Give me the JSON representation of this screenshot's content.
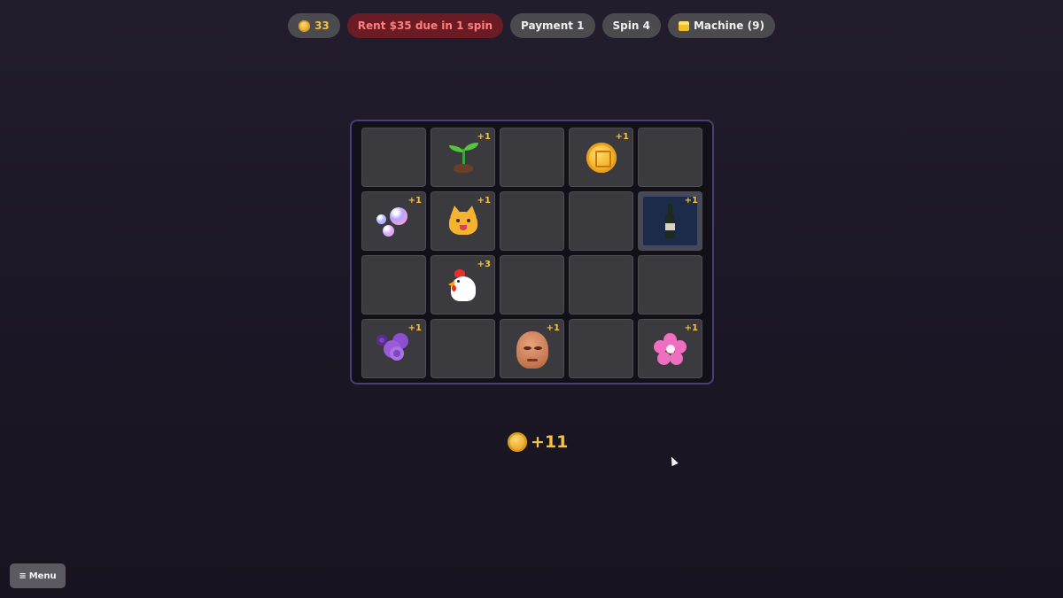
{
  "topbar": {
    "coins": "33",
    "rent": "Rent $35 due in 1 spin",
    "payment": "Payment 1",
    "spin": "Spin 4",
    "machine": "Machine (9)"
  },
  "board": {
    "cells": [
      {
        "symbol": "",
        "bonus": ""
      },
      {
        "symbol": "seedling-icon",
        "bonus": "+1"
      },
      {
        "symbol": "",
        "bonus": ""
      },
      {
        "symbol": "coin-icon",
        "bonus": "+1"
      },
      {
        "symbol": "",
        "bonus": ""
      },
      {
        "symbol": "bubbles-icon",
        "bonus": "+1"
      },
      {
        "symbol": "cat-icon",
        "bonus": "+1"
      },
      {
        "symbol": "",
        "bonus": ""
      },
      {
        "symbol": "",
        "bonus": ""
      },
      {
        "symbol": "wine-bottle-icon",
        "bonus": "+1"
      },
      {
        "symbol": "",
        "bonus": ""
      },
      {
        "symbol": "chicken-icon",
        "bonus": "+3"
      },
      {
        "symbol": "",
        "bonus": ""
      },
      {
        "symbol": "",
        "bonus": ""
      },
      {
        "symbol": "",
        "bonus": ""
      },
      {
        "symbol": "grapes-icon",
        "bonus": "+1"
      },
      {
        "symbol": "",
        "bonus": ""
      },
      {
        "symbol": "bald-face-icon",
        "bonus": "+1"
      },
      {
        "symbol": "",
        "bonus": ""
      },
      {
        "symbol": "cherry-blossom-icon",
        "bonus": "+1"
      }
    ]
  },
  "payout": "+11",
  "menu": {
    "icon": "≡",
    "label": "Menu"
  },
  "colors": {
    "coin_gold": "#f2c14a",
    "rent_bg": "#6b1b23",
    "rent_text": "#ff7f7f",
    "board_border": "#4a3f73"
  }
}
